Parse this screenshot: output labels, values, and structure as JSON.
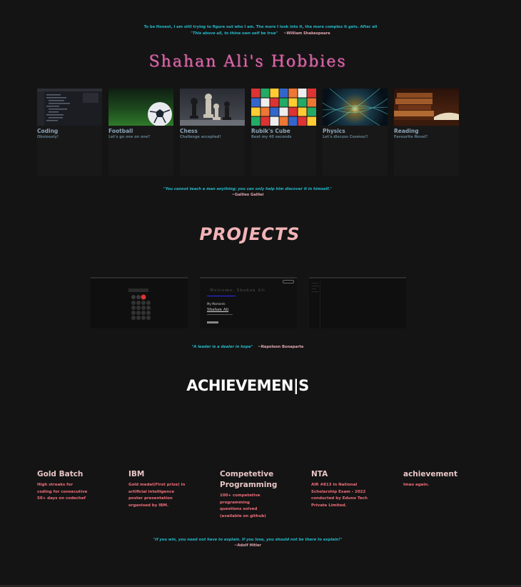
{
  "intro": {
    "text": "To be Honest, I am still trying to figure out who I am. The more I look into it, the more complex it gets. After all",
    "quote": "\"This above all, to thine own self be true\"",
    "author": "~William Shakespeare"
  },
  "hobbies": {
    "title": "Shahan Ali's Hobbies",
    "items": [
      {
        "name": "Coding",
        "desc": "Obviously!"
      },
      {
        "name": "Football",
        "desc": "Let's go one on one?"
      },
      {
        "name": "Chess",
        "desc": "Challenge accepted!"
      },
      {
        "name": "Rubik's Cube",
        "desc": "Beat my 40 seconds"
      },
      {
        "name": "Physics",
        "desc": "Let's discuss Cosmos!!"
      },
      {
        "name": "Reading",
        "desc": "Favourite Novel?"
      }
    ]
  },
  "quote1": {
    "text": "\"You cannot teach a man anything; you can only help him discover it in himself.\"",
    "author": "~Galileo Galilei"
  },
  "projects": {
    "title": "PROJECTS",
    "p2": {
      "heading": "Welcome, Shahan Ali",
      "line1": "My Moments",
      "line2": "Shahan Ali"
    }
  },
  "quote2": {
    "text": "\"A leader is a dealer in hope\"",
    "author": "~Napoleon Bonaparte"
  },
  "achievements": {
    "title": "ACHIEVEMEN|S",
    "items": [
      {
        "title": "Gold Batch",
        "desc": "High streaks for coding for consecutive 50+ days on codechef"
      },
      {
        "title": "IBM",
        "desc": "Gold medal(First prize) in artificial intelligence poster presentation organised by IBM."
      },
      {
        "title": "Competetive Programming",
        "desc": "100+ competetive programming questions solved (available on github)"
      },
      {
        "title": "NTA",
        "desc": "AIR #813 in National Scholarship Exam - 2022 conducted by Eduno Tech Private Limited."
      },
      {
        "title": "achievement",
        "desc": "lmao again."
      }
    ]
  },
  "quote3": {
    "text": "\"If you win, you need not have to explain. If you lose, you should not be there to explain!\"",
    "author": "~Adolf Hitler"
  }
}
